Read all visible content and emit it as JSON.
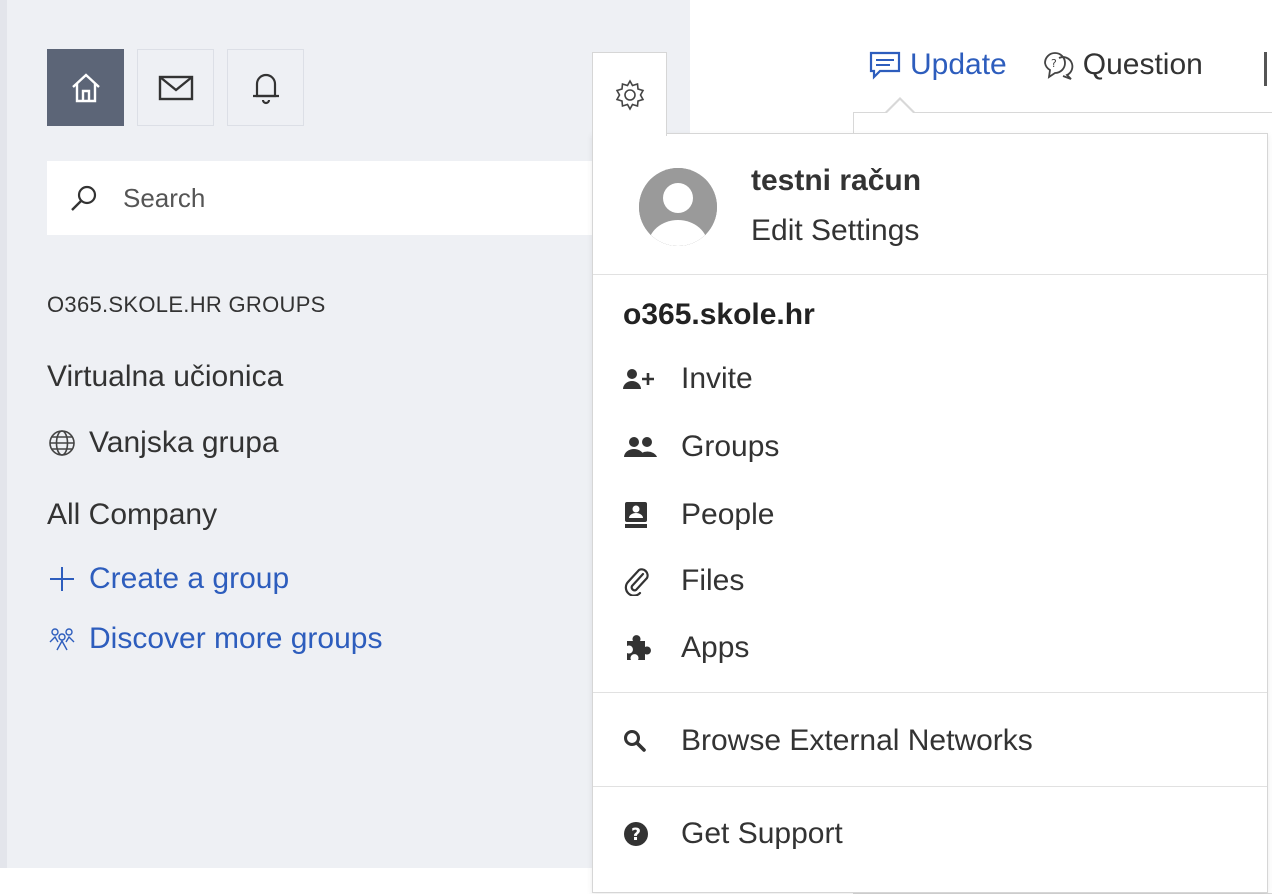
{
  "sidebar": {
    "top_icons": [
      {
        "name": "home-icon",
        "active": true
      },
      {
        "name": "mail-icon",
        "active": false
      },
      {
        "name": "bell-icon",
        "active": false
      }
    ],
    "search": {
      "placeholder": "Search"
    },
    "groups_heading": "O365.SKOLE.HR GROUPS",
    "groups": [
      {
        "label": "Virtualna učionica",
        "icon": null
      },
      {
        "label": "Vanjska grupa",
        "icon": "globe-icon"
      },
      {
        "label": "All Company",
        "icon": null
      }
    ],
    "create_group": "Create a group",
    "discover_groups": "Discover more groups"
  },
  "compose": {
    "tabs": [
      {
        "label": "Update",
        "icon": "comment-icon",
        "active": true
      },
      {
        "label": "Question",
        "icon": "question-bubble-icon",
        "active": false
      }
    ]
  },
  "settings_menu": {
    "user_name": "testni račun",
    "edit_settings": "Edit Settings",
    "network_name": "o365.skole.hr",
    "items": [
      {
        "label": "Invite",
        "icon": "add-person-icon"
      },
      {
        "label": "Groups",
        "icon": "people-icon"
      },
      {
        "label": "People",
        "icon": "address-book-icon"
      },
      {
        "label": "Files",
        "icon": "paperclip-icon"
      },
      {
        "label": "Apps",
        "icon": "puzzle-icon"
      }
    ],
    "browse_external": "Browse External Networks",
    "get_support": "Get Support"
  },
  "colors": {
    "link": "#2d5dbd",
    "sidebar_bg": "#eef0f4",
    "active_icon_bg": "#5c6577"
  }
}
